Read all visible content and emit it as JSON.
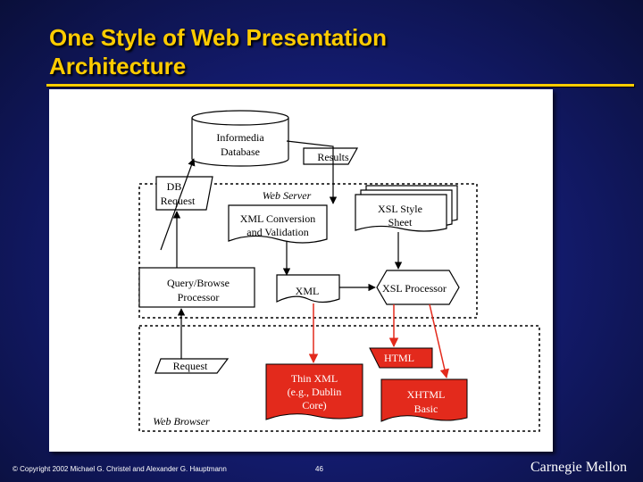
{
  "slide": {
    "title_line1": "One Style of Web Presentation",
    "title_line2": "Architecture",
    "copyright": "© Copyright 2002 Michael G. Christel and Alexander G. Hauptmann",
    "page_number": "46",
    "brand": "Carnegie Mellon"
  },
  "diagram": {
    "database": [
      "Informedia",
      "Database"
    ],
    "results": "Results",
    "db_request": [
      "DB",
      "Request"
    ],
    "web_server": "Web Server",
    "xml_conversion": [
      "XML Conversion",
      "and Validation"
    ],
    "xsl_style_sheet": [
      "XSL Style",
      "Sheet"
    ],
    "query_processor": [
      "Query/Browse",
      "Processor"
    ],
    "xml": "XML",
    "xsl_processor": "XSL Processor",
    "html": "HTML",
    "request": "Request",
    "thin_xml": [
      "Thin XML",
      "(e.g., Dublin",
      "Core)"
    ],
    "xhtml": [
      "XHTML",
      "Basic"
    ],
    "web_browser": "Web Browser"
  },
  "colors": {
    "title": "#ffcc00",
    "highlight": "#e32a1c",
    "background": "#141c72"
  }
}
